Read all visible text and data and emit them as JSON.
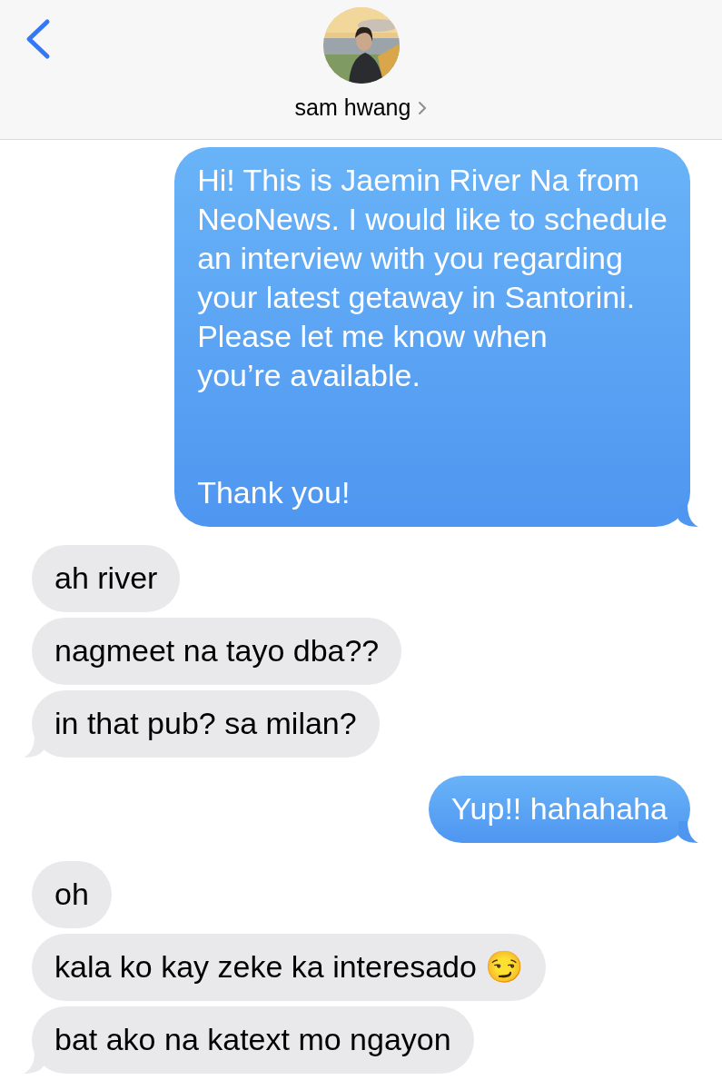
{
  "header": {
    "contact_name": "sam hwang"
  },
  "groups": [
    {
      "kind": "sent",
      "bubbles": [
        "Hi! This is Jaemin River Na from\nNeoNews. I would like to schedule\nan interview with you regarding\nyour latest getaway in Santorini.\nPlease let me know when\nyou’re available.\n\n\nThank you!"
      ]
    },
    {
      "kind": "received",
      "bubbles": [
        "ah river",
        "nagmeet na tayo dba??",
        "in that pub? sa milan?"
      ]
    },
    {
      "kind": "sent",
      "bubbles": [
        "Yup!! hahahaha"
      ]
    },
    {
      "kind": "received",
      "bubbles": [
        "oh",
        "kala ko kay zeke ka interesado 😏",
        "bat ako na katext mo ngayon"
      ]
    }
  ]
}
